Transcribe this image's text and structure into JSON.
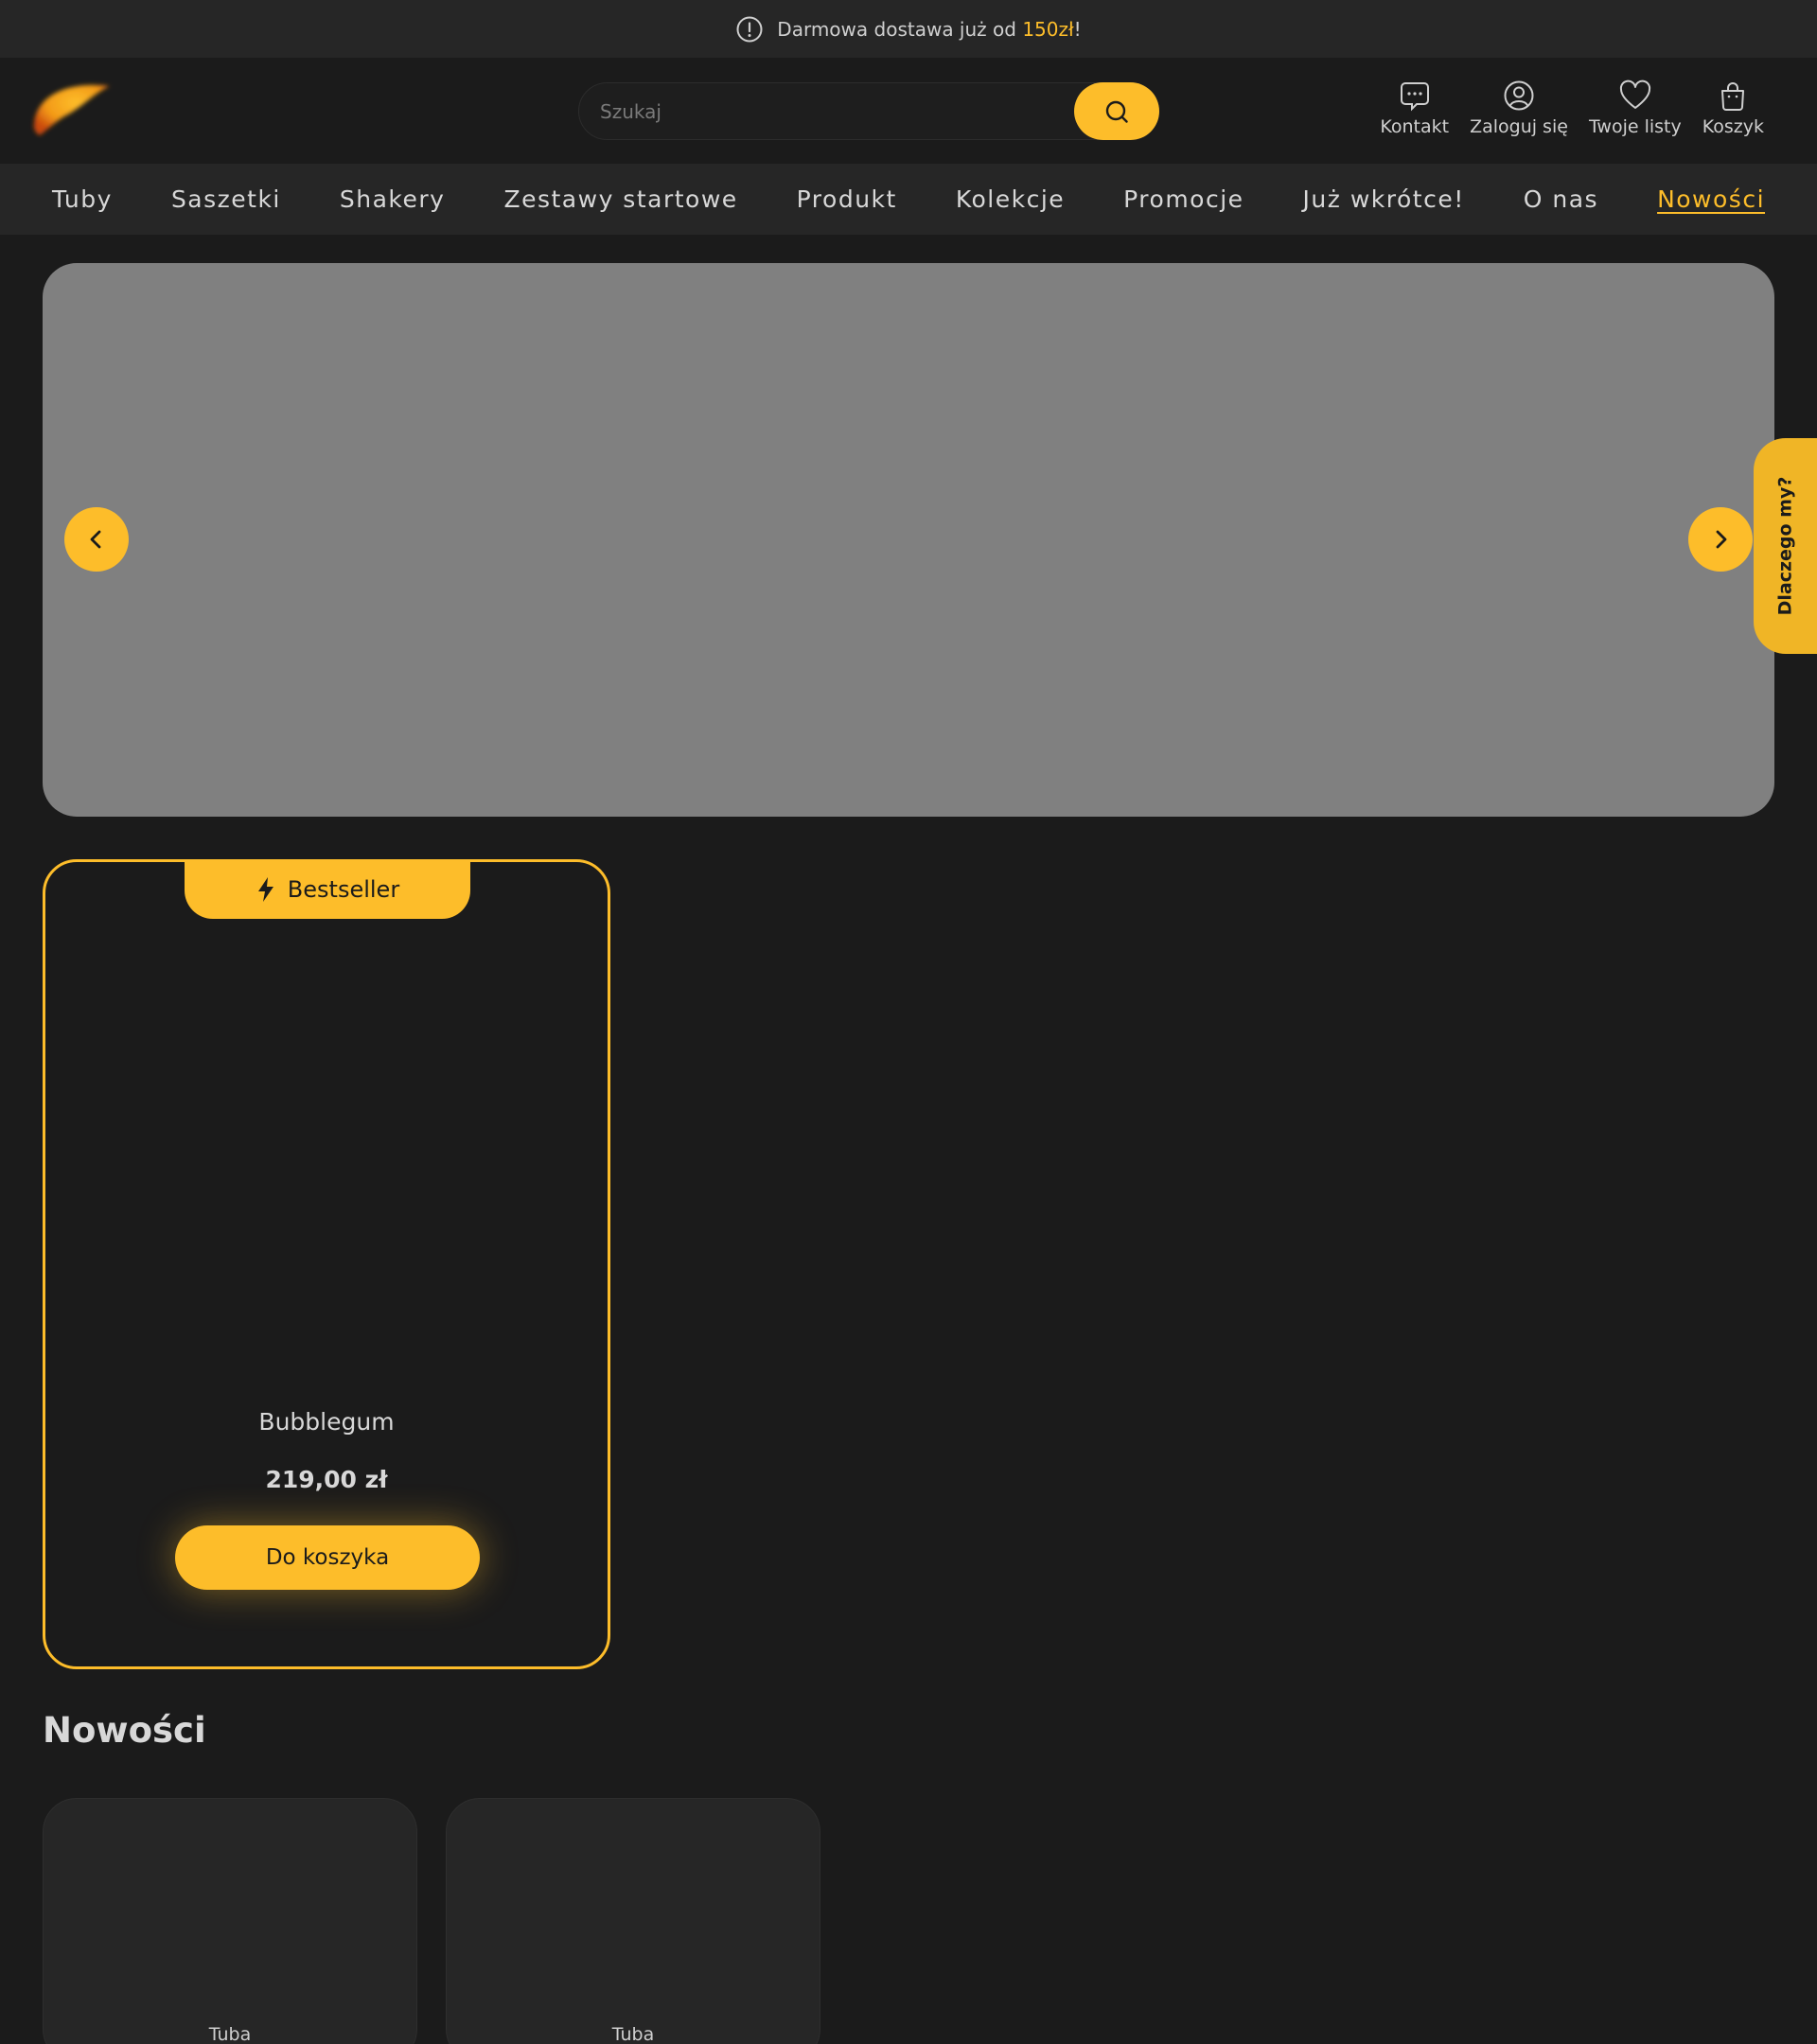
{
  "topbar": {
    "text_before": "Darmowa dostawa już od ",
    "amount": "150zł",
    "text_after": "!"
  },
  "header": {
    "search_placeholder": "Szukaj",
    "actions": [
      {
        "label": "Kontakt",
        "icon": "chat-icon"
      },
      {
        "label": "Zaloguj się",
        "icon": "user-icon"
      },
      {
        "label": "Twoje listy",
        "icon": "heart-icon"
      },
      {
        "label": "Koszyk",
        "icon": "bag-icon"
      }
    ]
  },
  "nav": {
    "items": [
      "Tuby",
      "Saszetki",
      "Shakery",
      "Zestawy startowe",
      "Produkt",
      "Kolekcje",
      "Promocje",
      "Już wkrótce!",
      "O nas",
      "Nowości"
    ],
    "active": "Nowości"
  },
  "side_tab": {
    "label": "Dlaczego my?"
  },
  "bestseller": {
    "badge": "Bestseller",
    "name": "Bubblegum",
    "price": "219,00 zł",
    "button": "Do koszyka"
  },
  "new_section": {
    "title": "Nowości",
    "cards": [
      {
        "label": "Tuba"
      },
      {
        "label": "Tuba"
      }
    ]
  },
  "colors": {
    "accent": "#fdbd2a",
    "background": "#1b1b1b",
    "bar": "#262626",
    "hero": "#808080"
  }
}
